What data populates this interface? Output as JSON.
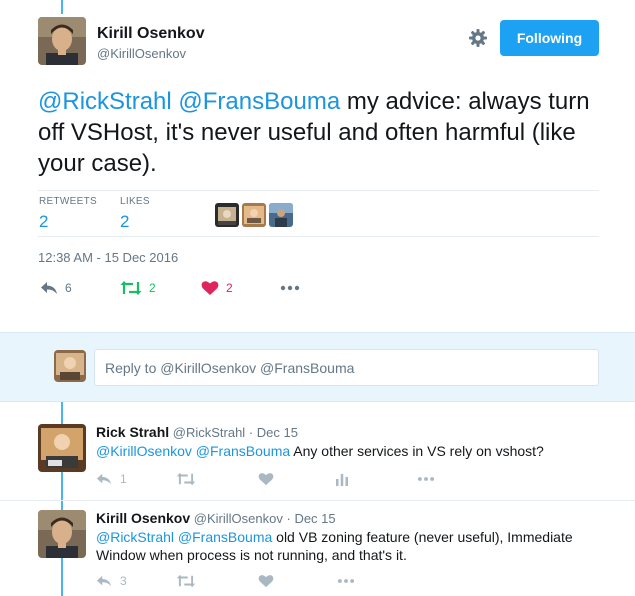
{
  "main_tweet": {
    "author_name": "Kirill Osenkov",
    "author_handle": "@KirillOsenkov",
    "follow_label": "Following",
    "text_mention_1": "@RickStrahl",
    "text_mention_2": "@FransBouma",
    "text_body": " my advice: always turn off VSHost, it's never useful and often harmful (like your case).",
    "retweets_label": "RETWEETS",
    "retweets_count": "2",
    "likes_label": "LIKES",
    "likes_count": "2",
    "timestamp": "12:38 AM - 15 Dec 2016",
    "actions": {
      "reply_count": "6",
      "retweet_count": "2",
      "like_count": "2"
    },
    "icons": {
      "settings": "gear-icon",
      "reply": "reply-icon",
      "retweet": "retweet-icon",
      "like": "heart-icon",
      "more": "more-icon"
    }
  },
  "reply_box": {
    "placeholder": "Reply to @KirillOsenkov @FransBouma"
  },
  "replies": [
    {
      "author_name": "Rick Strahl",
      "author_handle": "@RickStrahl",
      "date": "Dec 15",
      "mention_1": "@KirillOsenkov",
      "mention_2": "@FransBouma",
      "body": " Any other services in VS rely on vshost?",
      "reply_count": "1"
    },
    {
      "author_name": "Kirill Osenkov",
      "author_handle": "@KirillOsenkov",
      "date": "Dec 15",
      "mention_1": "@RickStrahl",
      "mention_2": "@FransBouma",
      "body": " old VB zoning feature (never useful), Immediate Window when process is not running, and that's it.",
      "reply_count": "3"
    }
  ],
  "colors": {
    "accent": "#1da1f2",
    "link": "#1b95e0",
    "retweet_green": "#17bf63",
    "like_red": "#e0245e",
    "muted": "#657786",
    "thread_line": "#4ab3f4"
  }
}
